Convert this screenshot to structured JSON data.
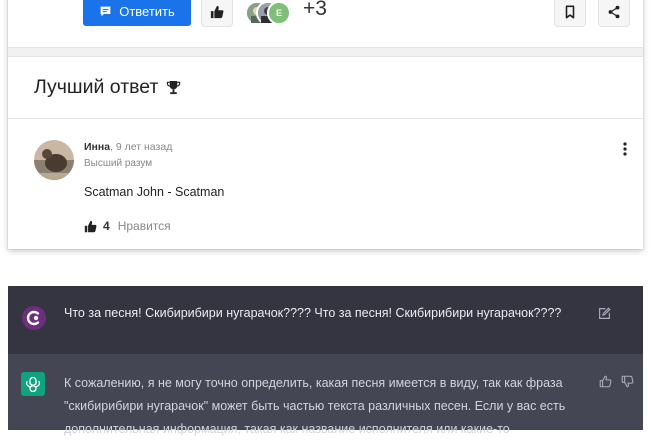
{
  "qa": {
    "reply_label": "Ответить",
    "participants": [
      {
        "initial": "",
        "color": "#7b8f78"
      },
      {
        "initial": "",
        "color": "#6e7480"
      },
      {
        "initial": "Е",
        "color": "#7fbf7a"
      }
    ],
    "more_count": "+3",
    "best_answer_title": "Лучший ответ",
    "answer": {
      "author": "Инна",
      "time": ", 9 лет назад",
      "rank": "Высший разум",
      "text": "Scatman John - Scatman",
      "likes": "4",
      "like_label": "Нравится"
    }
  },
  "chat": {
    "user_message": "Что за песня! Скибирибири нугарачок???? Что за песня! Скибирибири нугарачок????",
    "bot_message": "К сожалению, я не могу точно определить, какая песня имеется в виду, так как фраза \"скибирибири нугарачок\" может быть частью текста различных песен. Если у вас есть дополнительная информация, такая как название исполнителя или какие-то",
    "colors": {
      "user_bg": "#343541",
      "bot_bg": "#444654",
      "gpt_green": "#10a37f"
    }
  },
  "colors": {
    "primary": "#1a73e8"
  }
}
